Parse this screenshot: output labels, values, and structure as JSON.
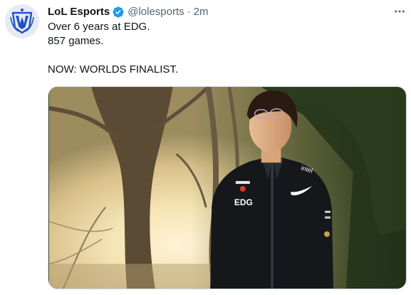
{
  "tweet": {
    "author": {
      "display_name": "LoL Esports",
      "handle": "@lolesports",
      "verified": true,
      "avatar_icon": "lol-worlds-logo-icon"
    },
    "separator": "·",
    "timestamp": "2m",
    "more_icon": "more-horizontal-icon",
    "text_lines": [
      "Over 6 years at EDG.",
      "857 games.",
      "",
      "NOW: WORLDS FINALIST."
    ],
    "media": {
      "jacket_texts": [
        "EDG",
        "intel"
      ],
      "icons": [
        "nike-swoosh-icon",
        "red-bull-logo-icon"
      ]
    },
    "colors": {
      "accent": "#1d9bf0",
      "secondary_text": "#536471",
      "logo_blue": "#1e4ec7"
    }
  }
}
